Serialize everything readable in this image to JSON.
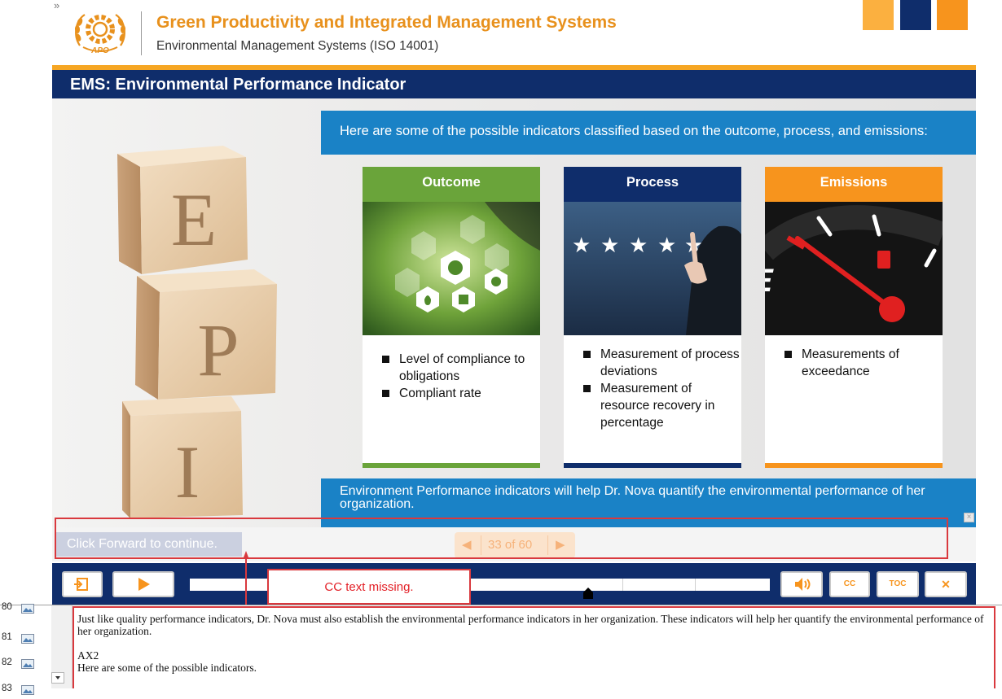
{
  "header": {
    "expand_glyph": "»",
    "logo_text": "APO",
    "course_title": "Green Productivity and Integrated Management Systems",
    "course_subtitle": "Environmental Management Systems (ISO 14001)"
  },
  "colors": {
    "navy": "#0f2d6b",
    "orange": "#f7941d",
    "light_orange": "#fbb040",
    "blue": "#1a82c6",
    "green": "#6aa43a",
    "annotation_red": "#d9393e"
  },
  "slide": {
    "title": "EMS: Environmental Performance Indicator",
    "block_letters": [
      "E",
      "P",
      "I"
    ],
    "intro": "Here are some of the possible indicators classified based on the outcome, process, and emissions:",
    "cards": [
      {
        "heading": "Outcome",
        "image": "sustainability-hexagon-icons-image",
        "items": [
          "Level of compliance to obligations",
          "Compliant rate"
        ]
      },
      {
        "heading": "Process",
        "image": "five-star-rating-image",
        "items": [
          "Measurement of process deviations",
          "Measurement of resource recovery in percentage"
        ]
      },
      {
        "heading": "Emissions",
        "image": "fuel-gauge-image",
        "items": [
          "Measurements of exceedance"
        ]
      }
    ],
    "summary": "Environment Performance indicators will help Dr. Nova quantify the environmental performance of her organization."
  },
  "navigation": {
    "forward_prompt": "Click Forward to continue.",
    "prev_glyph": "◀",
    "page_indicator": "33 of 60",
    "next_glyph": "▶",
    "close_small": "×"
  },
  "player": {
    "exit_icon": "exit-icon",
    "play_icon": "play-icon",
    "volume_icon": "volume-icon",
    "cc_label": "CC",
    "toc_label": "TOC",
    "close_label": "✕"
  },
  "annotation": {
    "cc_missing": "CC text missing."
  },
  "notes_panel": {
    "rows": [
      {
        "number": "80",
        "icon": "image-icon"
      },
      {
        "number": "81",
        "icon": "image-icon"
      },
      {
        "number": "82",
        "icon": "image-icon"
      },
      {
        "number": "83",
        "icon": "image-icon"
      }
    ],
    "paragraphs": [
      "Just like quality performance indicators, Dr. Nova must also establish the environmental performance indicators in her organization. These indicators will help her quantify the environmental performance of her organization.",
      "AX2",
      "Here are some of the possible indicators."
    ]
  }
}
